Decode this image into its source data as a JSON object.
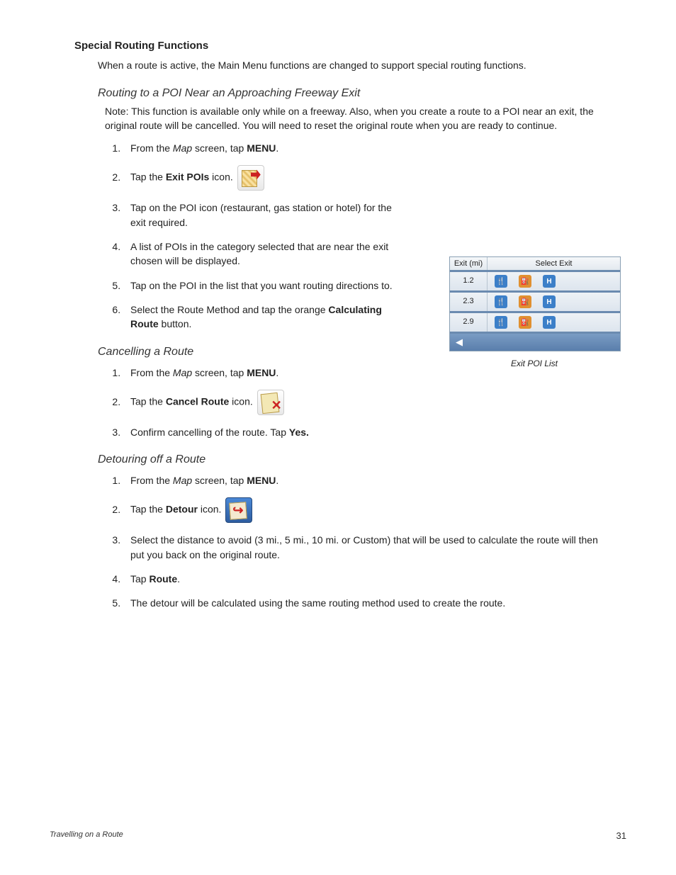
{
  "h2": "Special Routing Functions",
  "intro": "When a route is active, the Main Menu functions are changed to support special routing functions.",
  "sec1": {
    "title": "Routing to a POI Near an Approaching Freeway Exit",
    "note": "Note: This function is available only while on a freeway.  Also, when you create a route to a POI near an exit, the original route will be cancelled.  You will need to reset the original route when you are ready to continue.",
    "s1a": "From the ",
    "s1b": "Map",
    "s1c": " screen, tap ",
    "s1d": "MENU",
    "s1e": ".",
    "s2a": "Tap the ",
    "s2b": "Exit POIs",
    "s2c": " icon.",
    "s3": "Tap on the POI icon (restaurant, gas station or hotel) for the exit required.",
    "s4": "A list of POIs in the category selected that are near the exit chosen will be displayed.",
    "s5": "Tap on the POI in the list that you want routing directions to.",
    "s6a": "Select the Route Method and tap the orange ",
    "s6b": "Calculating Route",
    "s6c": " button."
  },
  "sec2": {
    "title": "Cancelling a Route",
    "s1a": "From the ",
    "s1b": "Map",
    "s1c": " screen, tap ",
    "s1d": "MENU",
    "s1e": ".",
    "s2a": "Tap the ",
    "s2b": "Cancel Route",
    "s2c": " icon.",
    "s3a": "Confirm cancelling of the route.  Tap ",
    "s3b": "Yes."
  },
  "sec3": {
    "title": "Detouring off a Route",
    "s1a": "From the ",
    "s1b": "Map",
    "s1c": " screen, tap ",
    "s1d": "MENU",
    "s1e": ".",
    "s2a": "Tap the ",
    "s2b": "Detour",
    "s2c": " icon.",
    "s3": "Select the distance to avoid (3 mi., 5 mi., 10 mi. or Custom) that will be used to calculate the route will then put you back on the original route.",
    "s4a": "Tap ",
    "s4b": "Route",
    "s4c": ".",
    "s5": "The detour will be calculated using the same routing method used to create the route."
  },
  "figure": {
    "hdr_exit": "Exit (mi)",
    "hdr_select": "Select Exit",
    "rows": [
      "1.2",
      "2.3",
      "2.9"
    ],
    "back": "◀",
    "caption": "Exit POI List"
  },
  "footer": {
    "section": "Travelling on a Route",
    "page": "31"
  }
}
